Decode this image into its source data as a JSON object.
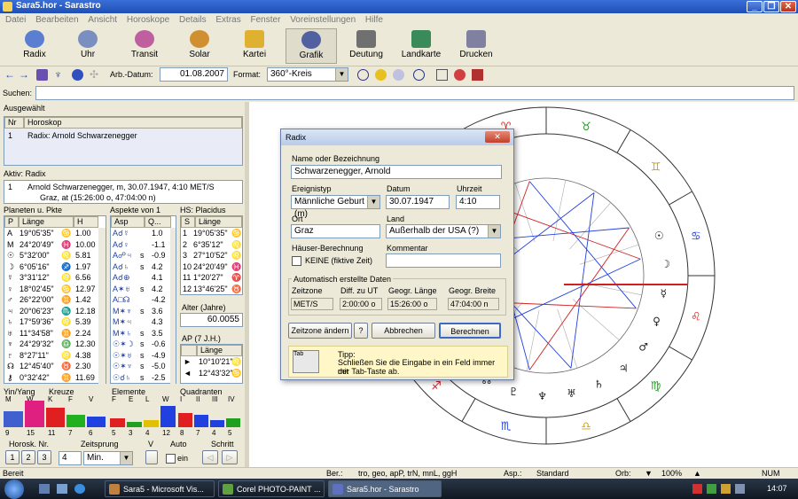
{
  "window": {
    "title": "Sara5.hor - Sarastro"
  },
  "menu": [
    "Datei",
    "Bearbeiten",
    "Ansicht",
    "Horoskope",
    "Details",
    "Extras",
    "Fenster",
    "Voreinstellungen",
    "Hilfe"
  ],
  "toolbar": [
    {
      "label": "Radix",
      "icon": "radix-icon",
      "color": "#5a7fd0"
    },
    {
      "label": "Uhr",
      "icon": "clock-icon",
      "color": "#7a8fc0"
    },
    {
      "label": "Transit",
      "icon": "transit-icon",
      "color": "#c05fa0"
    },
    {
      "label": "Solar",
      "icon": "solar-icon",
      "color": "#d09030"
    },
    {
      "label": "Kartei",
      "icon": "folder-icon",
      "color": "#e0b030"
    },
    {
      "label": "Grafik",
      "icon": "graphic-icon",
      "color": "#5060a0"
    },
    {
      "label": "Deutung",
      "icon": "book-icon",
      "color": "#707070"
    },
    {
      "label": "Landkarte",
      "icon": "map-icon",
      "color": "#3a8a5a"
    },
    {
      "label": "Drucken",
      "icon": "printer-icon",
      "color": "#8080a0"
    }
  ],
  "subtoolbar": {
    "date_label": "Arb.-Datum:",
    "date_value": "01.08.2007",
    "format_label": "Format:",
    "format_value": "360°-Kreis"
  },
  "search": {
    "label": "Suchen:",
    "value": ""
  },
  "selected": {
    "label": "Ausgewählt",
    "col_nr": "Nr",
    "col_horoskop": "Horoskop",
    "rows": [
      {
        "nr": "1",
        "name": "Radix: Arnold Schwarzenegger"
      }
    ]
  },
  "active": {
    "label": "Aktiv: Radix",
    "nr": "1",
    "line1": "Arnold Schwarzenegger, m, 30.07.1947, 4:10 MET/S",
    "line2": "Graz, at (15:26:00 o, 47:04:00 n)"
  },
  "planets": {
    "title": "Planeten u. Pkte",
    "col_p": "P",
    "col_laenge": "Länge",
    "col_h": "H",
    "rows": [
      {
        "p": "A",
        "l": "19°05'35\"",
        "s": "♋",
        "h": "1.00"
      },
      {
        "p": "M",
        "l": "24°20'49\"",
        "s": "♓",
        "h": "10.00"
      },
      {
        "p": "☉",
        "l": "5°32'00\"",
        "s": "♌",
        "h": "5.81"
      },
      {
        "p": "☽",
        "l": "6°05'16\"",
        "s": "♐",
        "h": "1.97"
      },
      {
        "p": "☿",
        "l": "3°31'12\"",
        "s": "♌",
        "h": "6.56"
      },
      {
        "p": "♀",
        "l": "18°02'45\"",
        "s": "♋",
        "h": "12.97"
      },
      {
        "p": "♂",
        "l": "26°22'00\"",
        "s": "♊",
        "h": "1.42"
      },
      {
        "p": "♃",
        "l": "20°06'23\"",
        "s": "♏",
        "h": "12.18"
      },
      {
        "p": "♄",
        "l": "17°59'36\"",
        "s": "♌",
        "h": "5.39"
      },
      {
        "p": "♅",
        "l": "11°34'58\"",
        "s": "♊",
        "h": "2.24"
      },
      {
        "p": "♆",
        "l": "24°29'32\"",
        "s": "♎",
        "h": "12.30"
      },
      {
        "p": "♇",
        "l": "8°27'11\"",
        "s": "♌",
        "h": "4.38"
      },
      {
        "p": "☊",
        "l": "12°45'40\"",
        "s": "♉",
        "h": "2.30"
      },
      {
        "p": "⚷",
        "l": "0°32'42\"",
        "s": "♊",
        "h": "11.69"
      }
    ]
  },
  "aspects": {
    "title": "Aspekte von 1",
    "col_asp": "Asp",
    "col_q": "Q...",
    "rows": [
      {
        "a": "A☌☿",
        "s": "",
        "q": "1.0"
      },
      {
        "a": "A☌♀",
        "s": "",
        "q": "-1.1"
      },
      {
        "a": "A☍♃",
        "s": "s",
        "q": "-0.9"
      },
      {
        "a": "A☌♄",
        "s": "s",
        "q": "4.2"
      },
      {
        "a": "A☌⊕",
        "s": "",
        "q": "4.1"
      },
      {
        "a": "A✶♅",
        "s": "s",
        "q": "4.2"
      },
      {
        "a": "A□☊",
        "s": "",
        "q": "-4.2"
      },
      {
        "a": "M✶♆",
        "s": "s",
        "q": "3.6"
      },
      {
        "a": "M✶♃",
        "s": "",
        "q": "4.3"
      },
      {
        "a": "M✶♄",
        "s": "s",
        "q": "3.5"
      },
      {
        "a": "☉✶☽",
        "s": "s",
        "q": "-0.6"
      },
      {
        "a": "☉✶♅",
        "s": "s",
        "q": "-4.9"
      },
      {
        "a": "☉✶♆",
        "s": "s",
        "q": "-5.0"
      },
      {
        "a": "☉☌♄",
        "s": "s",
        "q": "-2.5"
      }
    ]
  },
  "houses": {
    "title": "HS: Placidus",
    "col_s": "S",
    "col_laenge": "Länge",
    "rows": [
      {
        "n": "1",
        "l": "19°05'35\"",
        "s": "♋"
      },
      {
        "n": "2",
        "l": "6°35'12\"",
        "s": "♌"
      },
      {
        "n": "3",
        "l": "27°10'52\"",
        "s": "♌"
      },
      {
        "n": "10",
        "l": "24°20'49\"",
        "s": "♓"
      },
      {
        "n": "11",
        "l": "1°20'27\"",
        "s": "♈"
      },
      {
        "n": "12",
        "l": "13°46'25\"",
        "s": "♉"
      }
    ]
  },
  "alter": {
    "label": "Alter (Jahre)",
    "value": "60.0055"
  },
  "ap": {
    "label": "AP (7 J.H.)",
    "col_laenge": "Länge",
    "rows": [
      {
        "p": "►",
        "l": "10°10'21\"",
        "s": "♌"
      },
      {
        "p": "◄",
        "l": "12°43'32\"",
        "s": "♋"
      }
    ]
  },
  "yinyang": {
    "label": "Yin/Yang",
    "cats": [
      "M",
      "W"
    ],
    "counts": [
      9,
      15
    ],
    "colors": [
      "#4060d0",
      "#e02080"
    ]
  },
  "kreuze": {
    "label": "Kreuze",
    "cats": [
      "K",
      "F",
      "V"
    ],
    "counts": [
      11,
      7,
      6
    ],
    "colors": [
      "#e02020",
      "#20b020",
      "#2040e0"
    ]
  },
  "elemente": {
    "label": "Elemente",
    "cats": [
      "F",
      "E",
      "L",
      "W"
    ],
    "counts": [
      5,
      3,
      4,
      12
    ],
    "colors": [
      "#e02020",
      "#20a020",
      "#e0c000",
      "#2040e0"
    ]
  },
  "quadranten": {
    "label": "Quadranten",
    "cats": [
      "I",
      "II",
      "III",
      "IV"
    ],
    "counts": [
      8,
      7,
      4,
      5
    ],
    "colors": [
      "#e02020",
      "#2040e0",
      "#2040e0",
      "#20a020"
    ]
  },
  "bottomctl": {
    "horosk_label": "Horosk. Nr.",
    "nums": [
      "1",
      "2",
      "3"
    ],
    "zeitsprung_label": "Zeitsprung",
    "zeitsprung_value": "4",
    "unit_value": "Min.",
    "v_label": "V",
    "auto_label": "Auto",
    "auto_check": "ein",
    "schritt_label": "Schritt"
  },
  "dialog": {
    "title": "Radix",
    "name_label": "Name oder Bezeichnung",
    "name_value": "Schwarzenegger, Arnold",
    "ereignis_label": "Ereignistyp",
    "ereignis_value": "Männliche Geburt (m)",
    "datum_label": "Datum",
    "datum_value": "30.07.1947",
    "uhrzeit_label": "Uhrzeit",
    "uhrzeit_value": "4:10",
    "ort_label": "Ort",
    "ort_value": "Graz",
    "land_label": "Land",
    "land_value": "Außerhalb der USA (?)",
    "haeuser_label": "Häuser-Berechnung",
    "haeuser_check": "KEINE (fiktive Zeit)",
    "kommentar_label": "Kommentar",
    "kommentar_value": "",
    "auto_group": "Automatisch erstellte Daten",
    "zeitzone_label": "Zeitzone",
    "zeitzone_value": "MET/S",
    "diff_label": "Diff. zu UT",
    "diff_value": "2:00:00 o",
    "laenge_label": "Geogr. Länge",
    "laenge_value": "15:26:00 o",
    "breite_label": "Geogr. Breite",
    "breite_value": "47:04:00 n",
    "btn_zeitzone": "Zeitzone ändern",
    "btn_help": "?",
    "btn_cancel": "Abbrechen",
    "btn_calc": "Berechnen",
    "tip_key": "Tab",
    "tip_title": "Tipp:",
    "tip_line1": "Schließen Sie die Eingabe in ein Feld immer mit",
    "tip_line2": "der Tab-Taste ab."
  },
  "statusbar": {
    "left": "Bereit",
    "ber_label": "Ber.:",
    "ber_value": "tro, geo, apP, trN, mnL, ggH",
    "asp_label": "Asp.:",
    "asp_value": "Standard",
    "orb_label": "Orb:",
    "zoom_value": "100%",
    "num": "NUM"
  },
  "taskbar": {
    "items": [
      "Sara5 - Microsoft Vis...",
      "Corel PHOTO-PAINT ...",
      "Sara5.hor - Sarastro"
    ],
    "clock": "14:07"
  }
}
